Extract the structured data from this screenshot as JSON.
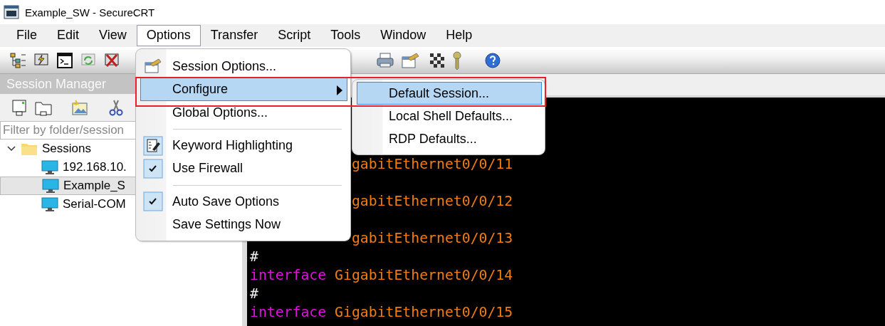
{
  "window": {
    "title": "Example_SW - SecureCRT"
  },
  "menu_bar": [
    {
      "label": "File",
      "selected": false
    },
    {
      "label": "Edit",
      "selected": false
    },
    {
      "label": "View",
      "selected": false
    },
    {
      "label": "Options",
      "selected": true
    },
    {
      "label": "Transfer",
      "selected": false
    },
    {
      "label": "Script",
      "selected": false
    },
    {
      "label": "Tools",
      "selected": false
    },
    {
      "label": "Window",
      "selected": false
    },
    {
      "label": "Help",
      "selected": false
    }
  ],
  "session_manager": {
    "title": "Session Manager",
    "filter": {
      "placeholder": "Filter by folder/session"
    },
    "tree": [
      {
        "label": "Sessions",
        "expanded": true,
        "children": [
          {
            "label": "192.168.10.",
            "selected": false
          },
          {
            "label": "Example_S",
            "selected": true
          },
          {
            "label": "Serial-COM",
            "selected": false
          }
        ]
      }
    ]
  },
  "terminal": {
    "lines": [
      {
        "kind": "covered"
      },
      {
        "kind": "covered"
      },
      {
        "kind": "covered"
      },
      {
        "kind": "partial",
        "name": "gabitEthernet0/0/11"
      },
      {
        "kind": "covered"
      },
      {
        "kind": "partial",
        "name": "gabitEthernet0/0/12"
      },
      {
        "kind": "covered"
      },
      {
        "kind": "partial",
        "name": "gabitEthernet0/0/13"
      },
      {
        "kind": "comment",
        "text": "#"
      },
      {
        "kind": "interface",
        "keyword": "interface",
        "name": "GigabitEthernet0/0/14"
      },
      {
        "kind": "comment",
        "text": "#"
      },
      {
        "kind": "interface",
        "keyword": "interface",
        "name": "GigabitEthernet0/0/15"
      }
    ]
  },
  "options_menu": {
    "items": [
      {
        "kind": "icon",
        "label": "Session Options...",
        "selected": false
      },
      {
        "kind": "submenu",
        "label": "Configure",
        "selected": true
      },
      {
        "kind": "plain",
        "label": "Global Options...",
        "selected": false
      },
      {
        "kind": "separator"
      },
      {
        "kind": "icon-toggle",
        "label": "Keyword Highlighting",
        "selected": false,
        "checked": true
      },
      {
        "kind": "toggle",
        "label": "Use Firewall",
        "selected": false,
        "checked": true
      },
      {
        "kind": "separator"
      },
      {
        "kind": "toggle",
        "label": "Auto Save Options",
        "selected": false,
        "checked": true
      },
      {
        "kind": "plain",
        "label": "Save Settings Now",
        "selected": false
      }
    ]
  },
  "configure_submenu": {
    "items": [
      {
        "label": "Default Session...",
        "selected": true
      },
      {
        "label": "Local Shell Defaults...",
        "selected": false
      },
      {
        "label": "RDP Defaults...",
        "selected": false
      }
    ]
  }
}
